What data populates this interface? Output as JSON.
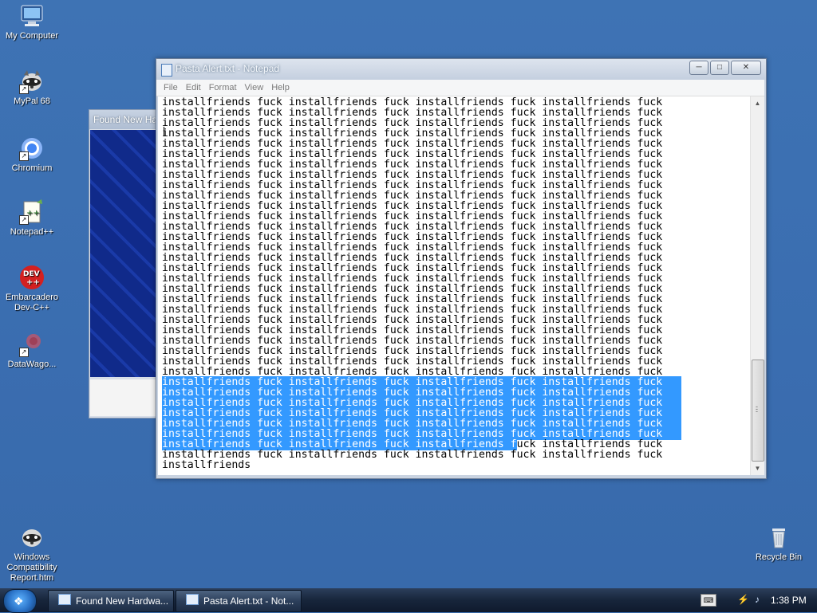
{
  "desktop": {
    "icons": [
      {
        "label": "My Computer"
      },
      {
        "label": "MyPal 68"
      },
      {
        "label": "Chromium"
      },
      {
        "label": "Notepad++"
      },
      {
        "label": "Embarcadero Dev-C++"
      },
      {
        "label": "DataWago..."
      },
      {
        "label": "Windows Compatibility Report.htm"
      },
      {
        "label": "Recycle Bin"
      }
    ]
  },
  "background_window": {
    "title": "Found New Ha"
  },
  "notepad": {
    "title": "Pasta Alert.txt - Notepad",
    "menu": [
      "File",
      "Edit",
      "Format",
      "View",
      "Help"
    ],
    "line_text": "installfriends fuck installfriends fuck installfriends fuck installfriends fuck",
    "last_line": "installfriends",
    "plain_lines_before_selection": 27,
    "fully_selected_lines": 6,
    "partial_selected_text": "installfriends fuck installfriends fuck installfriends f",
    "partial_rest_text": "uck installfriends fuck",
    "plain_lines_after_selection": 1,
    "buttons": {
      "minimize": "─",
      "maximize": "□",
      "close": "✕"
    }
  },
  "taskbar": {
    "buttons": [
      {
        "label": "Found New Hardwa..."
      },
      {
        "label": "Pasta Alert.txt - Not..."
      }
    ],
    "clock": "1:38 PM"
  },
  "colors": {
    "desktop": "#3a6fb0",
    "selection": "#3399ff",
    "taskbar": "#17253b"
  }
}
